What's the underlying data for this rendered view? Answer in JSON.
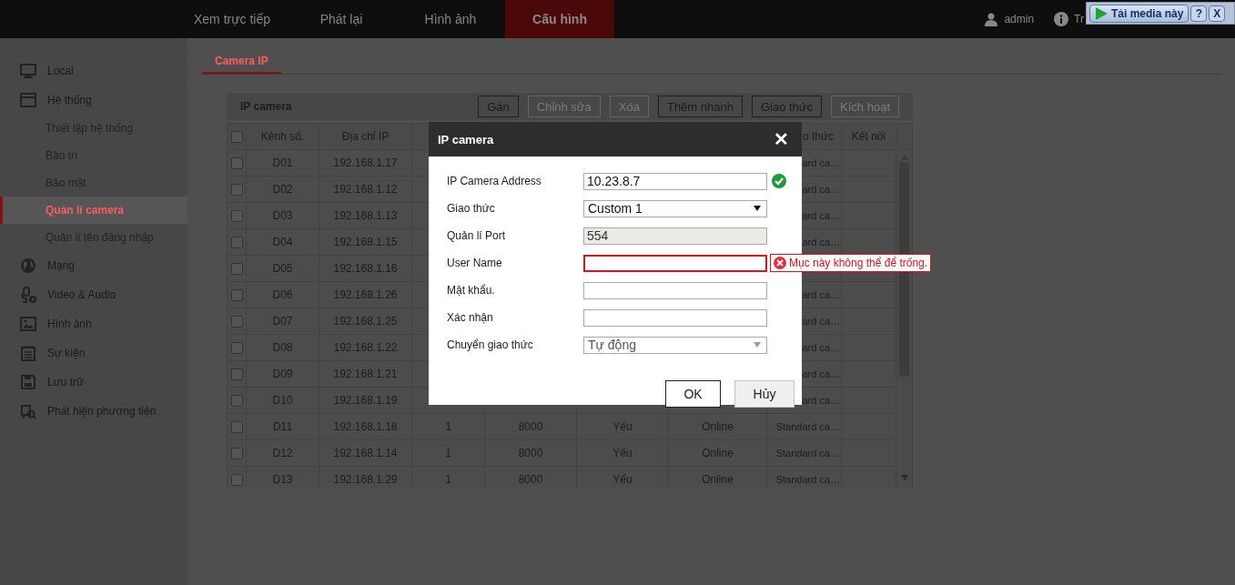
{
  "top_nav": {
    "tabs": [
      {
        "label": "Xem trực tiếp",
        "selected": false
      },
      {
        "label": "Phát lại",
        "selected": false
      },
      {
        "label": "Hình ảnh",
        "selected": false
      },
      {
        "label": "Cấu hình",
        "selected": true
      }
    ],
    "user": "admin",
    "info": "Tr"
  },
  "plugin_bar": {
    "label": "Tải media này",
    "help": "?",
    "close": "X"
  },
  "sidebar": {
    "items": [
      {
        "label": "Local",
        "selected": false
      },
      {
        "label": "Hệ thống",
        "selected": false,
        "children": [
          {
            "label": "Thiết lập hệ thống",
            "selected": false
          },
          {
            "label": "Bảo trì",
            "selected": false
          },
          {
            "label": "Bảo mật",
            "selected": false
          },
          {
            "label": "Quản lí camera",
            "selected": true
          },
          {
            "label": "Quản lí tên đăng nhập",
            "selected": false
          }
        ]
      },
      {
        "label": "Mạng",
        "selected": false
      },
      {
        "label": "Video & Audio",
        "selected": false
      },
      {
        "label": "Hình ảnh",
        "selected": false
      },
      {
        "label": "Sự kiện",
        "selected": false
      },
      {
        "label": "Lưu trữ",
        "selected": false
      },
      {
        "label": "Phát hiện phương tiện",
        "selected": false
      }
    ]
  },
  "sub_tabs": [
    {
      "label": "Camera IP",
      "selected": true
    }
  ],
  "table": {
    "title": "IP camera",
    "buttons": [
      {
        "label": "Gán",
        "disabled": false
      },
      {
        "label": "Chỉnh sửa",
        "disabled": true
      },
      {
        "label": "Xóa",
        "disabled": true
      },
      {
        "label": "Thêm nhanh",
        "disabled": false
      },
      {
        "label": "Giao thức",
        "disabled": false
      },
      {
        "label": "Kích hoạt",
        "disabled": true
      }
    ],
    "header": {
      "checked": false,
      "channel": "Kênh số.",
      "ip": "Địa chỉ IP",
      "column_7": "o thức",
      "connection": "Kết nối"
    },
    "rows": [
      {
        "checked": false,
        "channel": "D01",
        "ip": "192.168.1.17",
        "column_7": "ard ca…"
      },
      {
        "checked": false,
        "channel": "D02",
        "ip": "192.168.1.12",
        "column_7": "ard ca…"
      },
      {
        "checked": false,
        "channel": "D03",
        "ip": "192.168.1.13",
        "column_7": "ard ca…"
      },
      {
        "checked": false,
        "channel": "D04",
        "ip": "192.168.1.15",
        "column_7": "ard ca…"
      },
      {
        "checked": false,
        "channel": "D05",
        "ip": "192.168.1.16"
      },
      {
        "checked": false,
        "channel": "D06",
        "ip": "192.168.1.26",
        "column_7": "ard ca…"
      },
      {
        "checked": false,
        "channel": "D07",
        "ip": "192.168.1.25",
        "column_7": "ard ca…"
      },
      {
        "checked": false,
        "channel": "D08",
        "ip": "192.168.1.22",
        "column_7": "ard ca…"
      },
      {
        "checked": false,
        "channel": "D09",
        "ip": "192.168.1.21",
        "column_7": "ard ca…"
      },
      {
        "checked": false,
        "channel": "D10",
        "ip": "192.168.1.19",
        "column_7": "ard ca…"
      },
      {
        "checked": false,
        "channel": "D11",
        "ip": "192.168.1.18",
        "column_3": "1",
        "column_4": "8000",
        "column_5": "Yếu",
        "column_6": "Online",
        "column_7": "Standard ca…"
      },
      {
        "checked": false,
        "channel": "D12",
        "ip": "192.168.1.14",
        "column_3": "1",
        "column_4": "8000",
        "column_5": "Yếu",
        "column_6": "Online",
        "column_7": "Standard ca…"
      },
      {
        "checked": false,
        "channel": "D13",
        "ip": "192.168.1.29",
        "column_3": "1",
        "column_4": "8000",
        "column_5": "Yếu",
        "column_6": "Online",
        "column_7": "Standard ca…"
      }
    ]
  },
  "dialog": {
    "title": "IP camera",
    "close": "✕",
    "fields": [
      {
        "label": "IP Camera Address",
        "kind": "text",
        "value": "10.23.8.7",
        "disabled": false,
        "valid": true,
        "invalid": false
      },
      {
        "label": "Giao thức",
        "kind": "select",
        "value": "Custom 1",
        "disabled": false,
        "valid": false,
        "invalid": false
      },
      {
        "label": "Quản lí Port",
        "kind": "text",
        "value": "554",
        "disabled": true,
        "valid": false,
        "invalid": false
      },
      {
        "label": "User Name",
        "kind": "text",
        "disabled": false,
        "valid": false,
        "invalid": true,
        "error_message": "Mục này không thể để trống."
      },
      {
        "label": "Mật khẩu.",
        "kind": "text",
        "disabled": false,
        "valid": false,
        "invalid": false
      },
      {
        "label": "Xác nhận",
        "kind": "text",
        "disabled": false,
        "valid": false,
        "invalid": false
      },
      {
        "label": "Chuyển giao thức",
        "kind": "select",
        "value": "Tự động",
        "disabled": true,
        "valid": false,
        "invalid": false
      }
    ],
    "buttons": [
      {
        "label": "OK",
        "kind": "primary"
      },
      {
        "label": "Hủy",
        "kind": "secondary"
      }
    ]
  }
}
